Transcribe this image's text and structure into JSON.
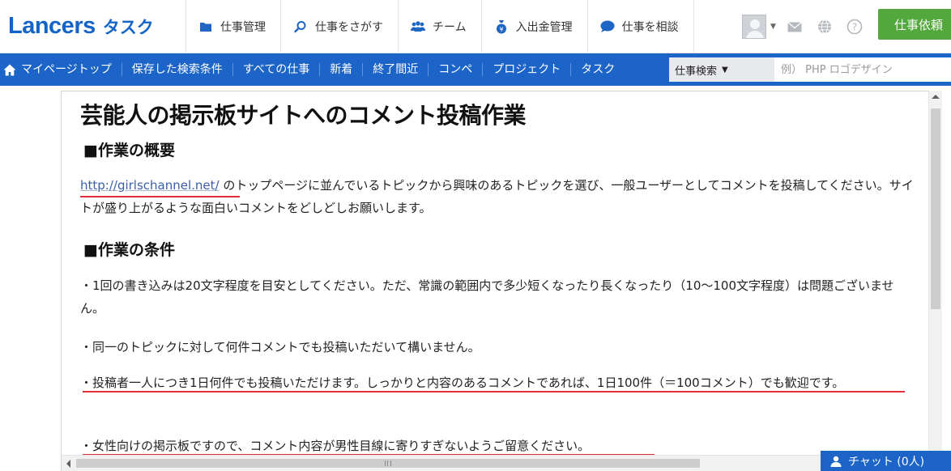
{
  "header": {
    "logo": {
      "main": "Lancers",
      "sub": "タスク"
    },
    "nav": [
      {
        "label": "仕事管理",
        "icon": "folder-icon"
      },
      {
        "label": "仕事をさがす",
        "icon": "search-icon"
      },
      {
        "label": "チーム",
        "icon": "team-icon"
      },
      {
        "label": "入出金管理",
        "icon": "money-bag-icon"
      },
      {
        "label": "仕事を相談",
        "icon": "chat-bubble-icon"
      }
    ],
    "order_button": "仕事依頼"
  },
  "subnav": {
    "items": [
      "マイページトップ",
      "保存した検索条件",
      "すべての仕事",
      "新着",
      "終了間近",
      "コンペ",
      "プロジェクト",
      "タスク"
    ],
    "search_category": "仕事検索",
    "search_placeholder": "例） PHP ロゴデザイン"
  },
  "content": {
    "title": "芸能人の掲示板サイトへのコメント投稿作業",
    "overview_heading": "■作業の概要",
    "overview_link": "http://girlschannel.net/",
    "overview_text": " のトップページに並んでいるトピックから興味のあるトピックを選び、一般ユーザーとしてコメントを投稿してください。サイトが盛り上がるような面白いコメントをどしどしお願いします。",
    "conditions_heading": "■作業の条件",
    "conditions": [
      "・1回の書き込みは20文字程度を目安としてください。ただ、常識の範囲内で多少短くなったり長くなったり（10～100文字程度）は問題ございません。",
      "・同一のトピックに対して何件コメントでも投稿いただいて構いません。",
      "・投稿者一人につき1日何件でも投稿いただけます。しっかりと内容のあるコメントであれば、1日100件（＝100コメント）でも歓迎です。",
      "・女性向けの掲示板ですので、コメント内容が男性目線に寄りすぎないようご留意ください。"
    ]
  },
  "chat": {
    "label": "チャット (0人)"
  },
  "colors": {
    "brand_blue": "#1c64c8",
    "order_green": "#52a83a",
    "underline_red": "#e0303a"
  }
}
